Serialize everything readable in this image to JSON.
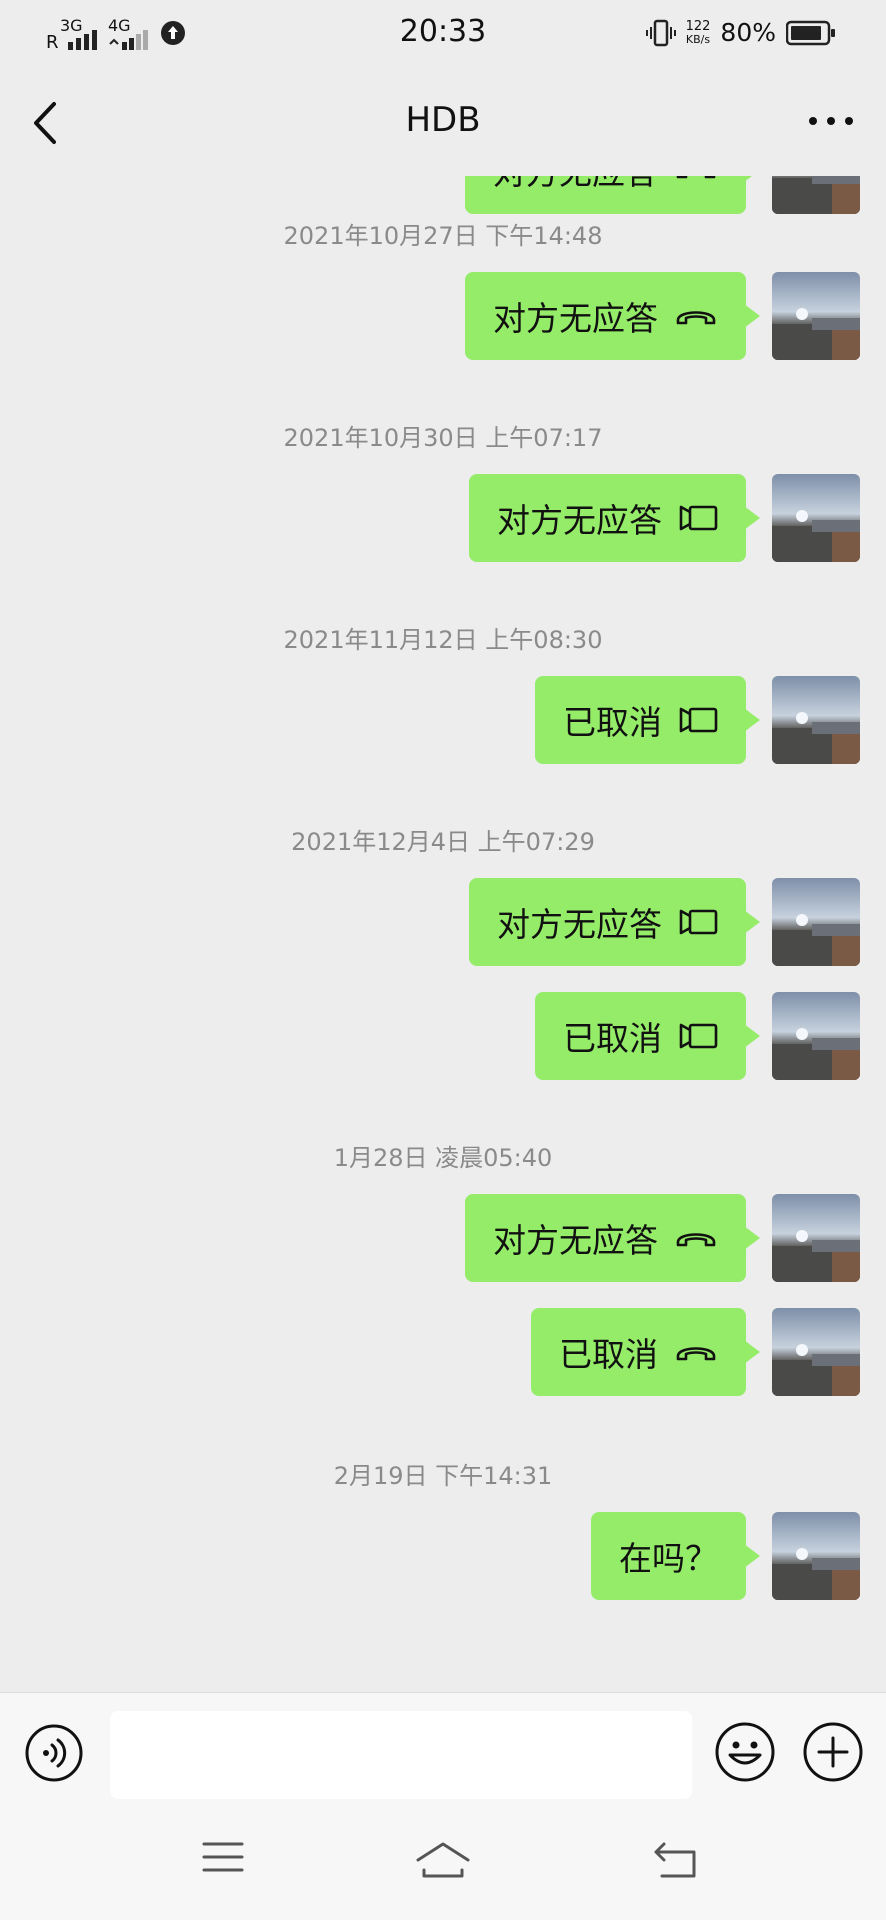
{
  "status": {
    "net1": "3G",
    "roam": "R",
    "net2": "4G",
    "time": "20:33",
    "speed_top": "122",
    "speed_unit": "KB/s",
    "battery": "80%"
  },
  "nav": {
    "title": "HDB"
  },
  "messages": [
    {
      "text": "对方无应答",
      "icon": "phone-hangup-icon"
    },
    {
      "timestamp": "2021年10月27日 下午14:48"
    },
    {
      "text": "对方无应答",
      "icon": "phone-hangup-icon"
    },
    {
      "timestamp": "2021年10月30日 上午07:17"
    },
    {
      "text": "对方无应答",
      "icon": "video-call-icon"
    },
    {
      "timestamp": "2021年11月12日 上午08:30"
    },
    {
      "text": "已取消",
      "icon": "video-call-icon"
    },
    {
      "timestamp": "2021年12月4日 上午07:29"
    },
    {
      "text": "对方无应答",
      "icon": "video-call-icon"
    },
    {
      "text": "已取消",
      "icon": "video-call-icon"
    },
    {
      "timestamp": "1月28日 凌晨05:40"
    },
    {
      "text": "对方无应答",
      "icon": "phone-hangup-icon"
    },
    {
      "text": "已取消",
      "icon": "phone-hangup-icon"
    },
    {
      "timestamp": "2月19日 下午14:31"
    },
    {
      "text": "在吗？",
      "icon": ""
    }
  ],
  "input": {
    "value": ""
  },
  "colors": {
    "bubble": "#95ec69",
    "background": "#ededed"
  }
}
